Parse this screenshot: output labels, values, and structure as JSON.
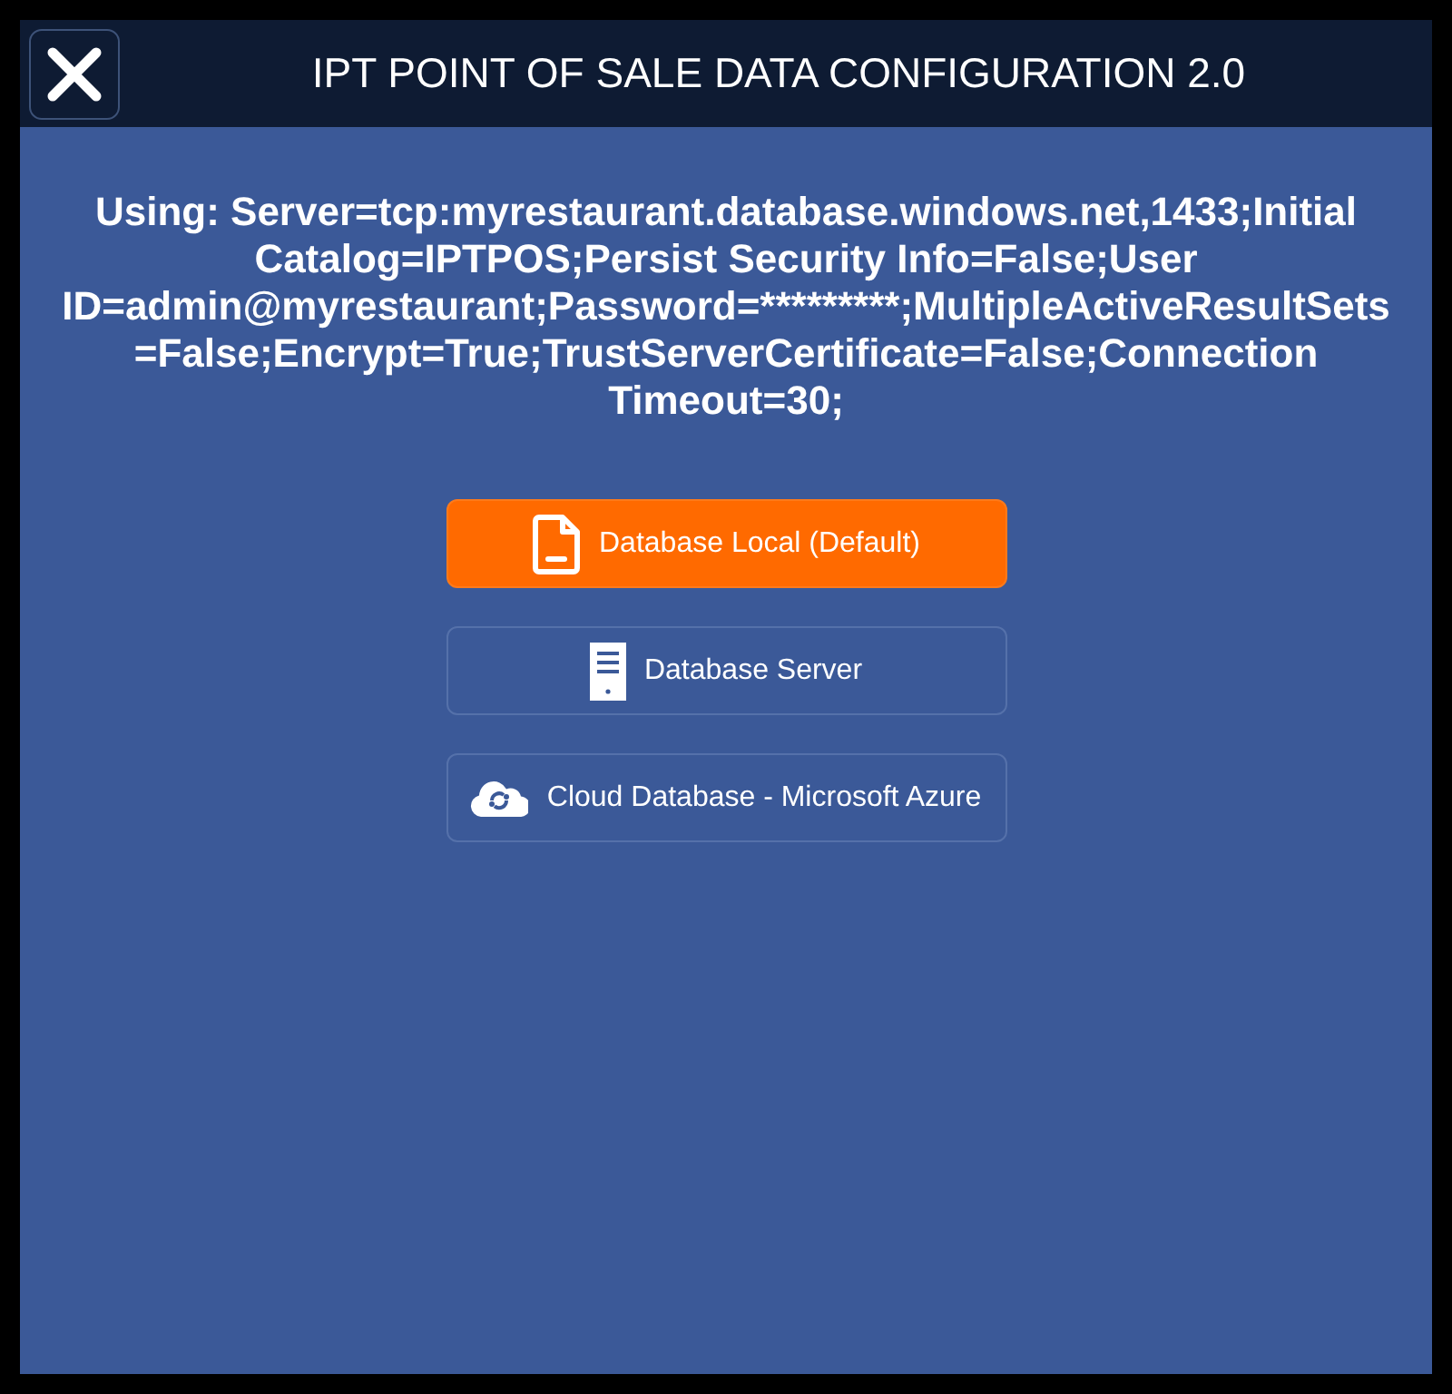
{
  "window": {
    "title": "IPT POINT OF SALE DATA CONFIGURATION 2.0"
  },
  "connection_info": "Using: Server=tcp:myrestaurant.database.windows.net,1433;Initial Catalog=IPTPOS;Persist Security Info=False;User ID=admin@myrestaurant;Password=*********;MultipleActiveResultSets=False;Encrypt=True;TrustServerCertificate=False;Connection Timeout=30;",
  "options": [
    {
      "kind": "local",
      "label": "Database Local (Default)",
      "selected": true
    },
    {
      "kind": "server",
      "label": "Database Server",
      "selected": false
    },
    {
      "kind": "cloud",
      "label": "Cloud Database - Microsoft Azure",
      "selected": false
    }
  ]
}
